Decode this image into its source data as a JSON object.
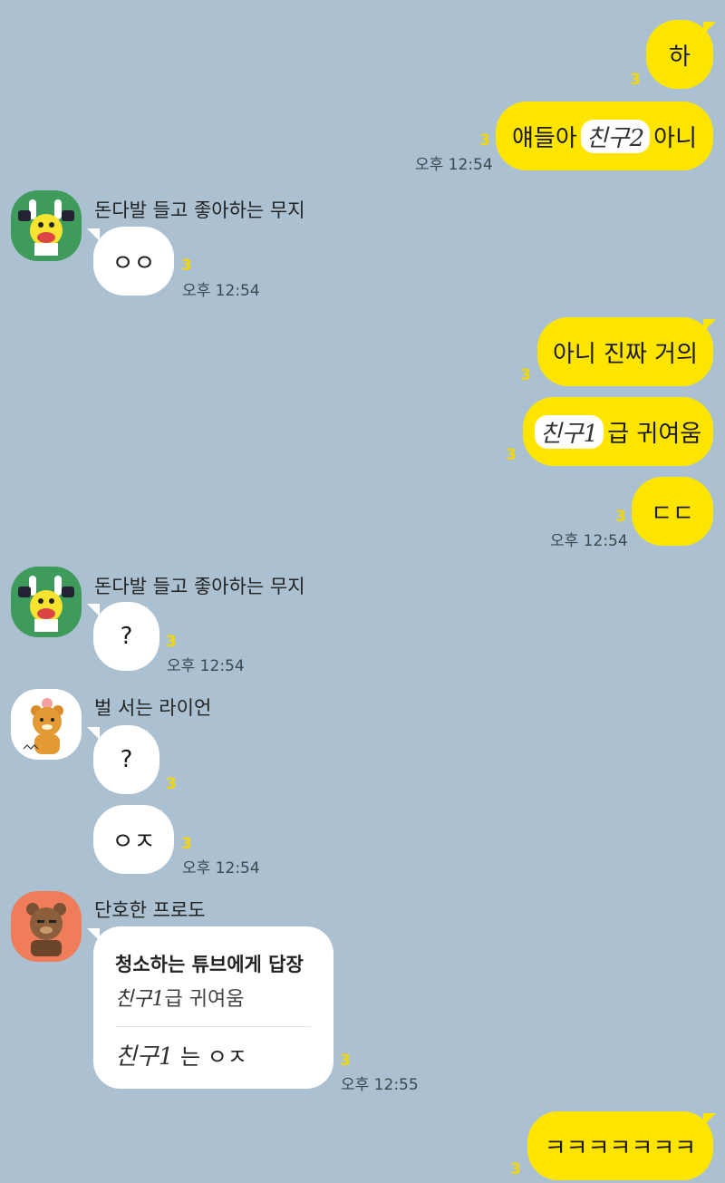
{
  "messages": {
    "m1": {
      "text": "하",
      "unread": "3"
    },
    "m2": {
      "prefix": "얘들아",
      "masked": "친구2",
      "suffix": "아니",
      "unread": "3",
      "time": "오후 12:54"
    },
    "g1": {
      "name": "돈다발 들고 좋아하는 무지",
      "text": "ㅇㅇ",
      "unread": "3",
      "time": "오후 12:54"
    },
    "m3": {
      "text": "아니 진짜 거의",
      "unread": "3"
    },
    "m4": {
      "masked": "친구1",
      "suffix": "급 귀여움",
      "unread": "3"
    },
    "m5": {
      "text": "ㄷㄷ",
      "unread": "3",
      "time": "오후 12:54"
    },
    "g2": {
      "name": "돈다발 들고 좋아하는 무지",
      "text": "?",
      "unread": "3",
      "time": "오후 12:54"
    },
    "g3": {
      "name": "벌 서는 라이언",
      "text1": "?",
      "unread1": "3",
      "text2": "ㅇㅈ",
      "unread2": "3",
      "time": "오후 12:54"
    },
    "g4": {
      "name": "단호한 프로도",
      "reply_header": "청소하는 튜브에게 답장",
      "quote_masked": "친구1",
      "quote_suffix": "급 귀여움",
      "body_masked": "친구1",
      "body_suffix": " 는 ㅇㅈ",
      "unread": "3",
      "time": "오후 12:55"
    },
    "m6": {
      "text": "ㅋㅋㅋㅋㅋㅋㅋ",
      "unread": "3"
    }
  },
  "avatars": {
    "muzi": "muzi-avatar",
    "ryan": "ryan-avatar",
    "frodo": "frodo-avatar"
  },
  "colors": {
    "background": "#abc1d1",
    "my_bubble": "#fee500",
    "their_bubble": "#ffffff",
    "unread": "#f2d600"
  }
}
